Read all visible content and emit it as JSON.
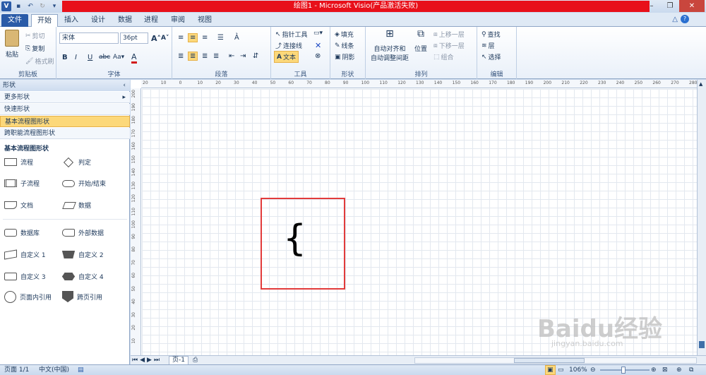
{
  "title": "绘图1 - Microsoft Visio(产品激活失败)",
  "tabs": [
    "文件",
    "开始",
    "插入",
    "设计",
    "数据",
    "进程",
    "审阅",
    "视图"
  ],
  "clipboard": {
    "paste": "粘贴",
    "cut": "剪切",
    "copy": "复制",
    "format_painter": "格式刷",
    "label": "剪贴板"
  },
  "font": {
    "name": "宋体",
    "size": "36pt",
    "label": "字体"
  },
  "paragraph": {
    "label": "段落"
  },
  "tools": {
    "pointer": "指针工具",
    "connector": "连接线",
    "text": "文本",
    "label": "工具"
  },
  "shape": {
    "fill": "填充",
    "line": "线条",
    "shadow": "阴影",
    "label": "形状"
  },
  "arrange": {
    "auto_align": "自动对齐和",
    "auto_space": "自动调整间距",
    "position": "位置",
    "bring_forward": "上移一层",
    "send_backward": "下移一层",
    "group": "组合",
    "label": "排列"
  },
  "editing": {
    "find": "查找",
    "layers": "层",
    "select": "选择",
    "label": "编辑"
  },
  "shapes_panel": {
    "title": "形状",
    "more": "更多形状",
    "quick": "快速形状",
    "basic": "基本流程图形状",
    "cross": "跨职能流程图形状",
    "section": "基本流程图形状",
    "items": [
      "流程",
      "判定",
      "子流程",
      "开始/结束",
      "文档",
      "数据",
      "数据库",
      "外部数据",
      "自定义 1",
      "自定义 2",
      "自定义 3",
      "自定义 4",
      "页面内引用",
      "跨页引用"
    ]
  },
  "canvas": {
    "brace": "{"
  },
  "page_tab": "页-1",
  "status": {
    "page": "页面 1/1",
    "language": "中文(中国)",
    "zoom": "106%"
  },
  "watermark": {
    "brand": "Baidu经验",
    "url": "jingyan.baidu.com"
  },
  "ruler_h": [
    "20",
    "10",
    "0",
    "10",
    "20",
    "30",
    "40",
    "50",
    "60",
    "70",
    "80",
    "90",
    "100",
    "110",
    "120",
    "130",
    "140",
    "150",
    "160",
    "170",
    "180",
    "190",
    "200",
    "210",
    "220",
    "230",
    "240",
    "250",
    "260",
    "270",
    "280"
  ],
  "ruler_v": [
    "200",
    "190",
    "180",
    "170",
    "160",
    "150",
    "140",
    "130",
    "120",
    "110",
    "100",
    "90",
    "80",
    "70",
    "60",
    "50",
    "40",
    "30",
    "20",
    "10"
  ],
  "colors": {
    "title_red": "#e8101a",
    "highlight": "#fcd87a",
    "frame": "#e23b3b"
  }
}
